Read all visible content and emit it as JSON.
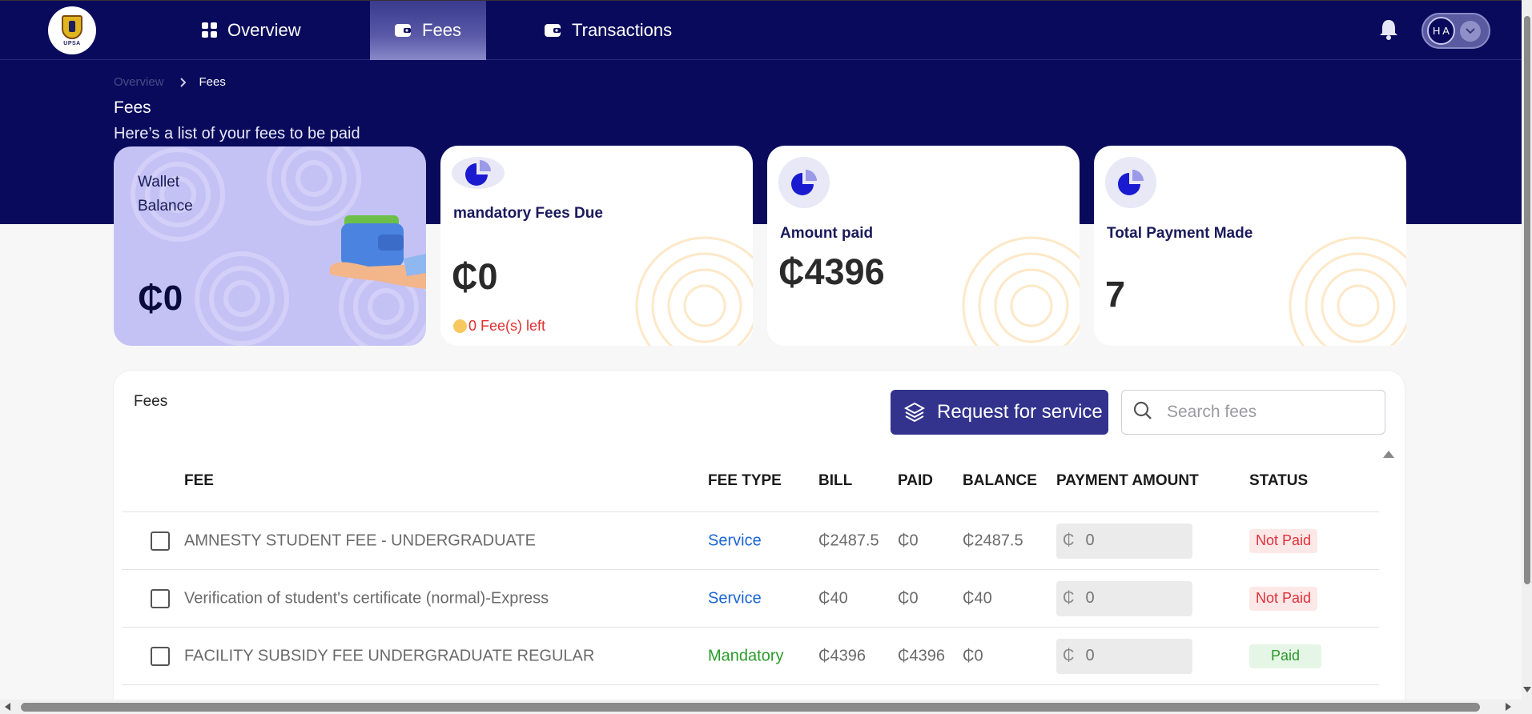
{
  "nav": {
    "logo_text": "UPSA",
    "tabs": [
      {
        "label": "Overview",
        "icon": "grid-icon"
      },
      {
        "label": "Fees",
        "icon": "wallet-icon",
        "active": true
      },
      {
        "label": "Transactions",
        "icon": "wallet-icon"
      }
    ],
    "user_initials": "H A"
  },
  "breadcrumb": {
    "previous": "Overview",
    "current": "Fees"
  },
  "header": {
    "title": "Fees",
    "subtitle": "Here’s a list of your fees to be paid"
  },
  "cards": {
    "wallet": {
      "label": "Wallet Balance",
      "value": "₵0"
    },
    "mandatory_due": {
      "label": "mandatory Fees Due",
      "value": "₵0",
      "note": "0 Fee(s) left"
    },
    "amount_paid": {
      "label": "Amount paid",
      "value": "₵4396"
    },
    "total_payment": {
      "label": "Total Payment Made",
      "value": "7"
    }
  },
  "fees_panel": {
    "title": "Fees",
    "request_button": "Request for service",
    "search_placeholder": "Search fees",
    "columns": [
      "FEE",
      "FEE TYPE",
      "BILL",
      "PAID",
      "BALANCE",
      "PAYMENT AMOUNT",
      "STATUS"
    ],
    "rows": [
      {
        "fee": "AMNESTY STUDENT FEE - UNDERGRADUATE",
        "type": "Service",
        "bill": "₵2487.5",
        "paid": "₵0",
        "balance": "₵2487.5",
        "currency": "₵",
        "amount_placeholder": "0",
        "status": "Not Paid"
      },
      {
        "fee": "Verification of student's certificate (normal)-Express",
        "type": "Service",
        "bill": "₵40",
        "paid": "₵0",
        "balance": "₵40",
        "currency": "₵",
        "amount_placeholder": "0",
        "status": "Not Paid"
      },
      {
        "fee": "FACILITY SUBSIDY FEE UNDERGRADUATE REGULAR",
        "type": "Mandatory",
        "bill": "₵4396",
        "paid": "₵4396",
        "balance": "₵0",
        "currency": "₵",
        "amount_placeholder": "0",
        "status": "Paid"
      }
    ]
  },
  "colors": {
    "hero": "#0a0a5c",
    "accent": "#33338e",
    "wallet_card": "#c4c2f4",
    "not_paid": "#e0303a",
    "paid": "#2a9a2a",
    "service": "#1a66d8"
  }
}
